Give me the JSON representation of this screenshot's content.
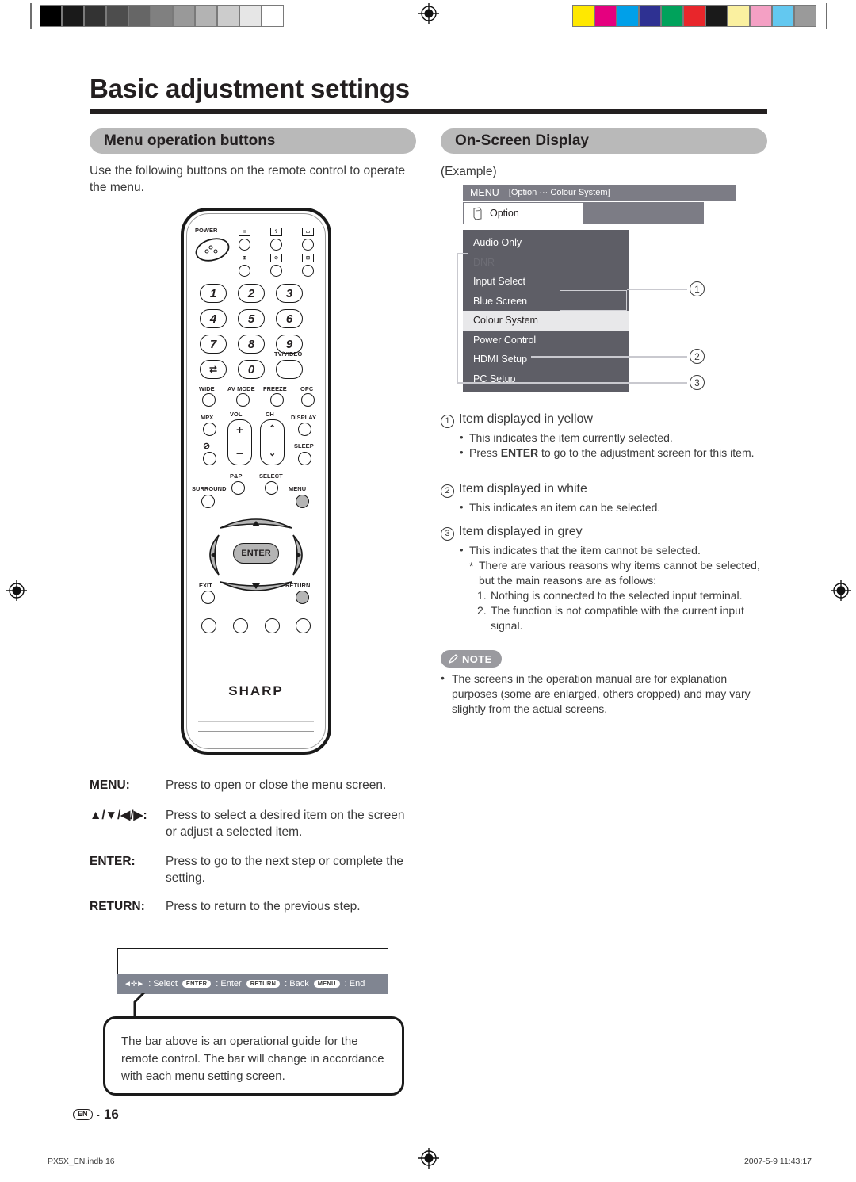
{
  "page": {
    "title": "Basic adjustment settings",
    "folio_badge": "EN",
    "folio_separator": "-",
    "folio_number": "16",
    "footer_left": "PX5X_EN.indb   16",
    "footer_right": "2007-5-9   11:43:17"
  },
  "print_marks": {
    "greyscale_swatches": [
      "#000000",
      "#1a1a1a",
      "#333333",
      "#4d4d4d",
      "#666666",
      "#808080",
      "#999999",
      "#b3b3b3",
      "#cccccc",
      "#e6e6e6",
      "#ffffff"
    ],
    "color_swatches": [
      "#ffe800",
      "#e5007f",
      "#00a0e9",
      "#2e3192",
      "#00a25b",
      "#e8262b",
      "#1a1a1a",
      "#faf0a0",
      "#f4a0c4",
      "#63c8f0",
      "#9a9a9a"
    ]
  },
  "left_column": {
    "section_title": "Menu operation buttons",
    "intro": "Use the following buttons on the remote control to operate the menu.",
    "remote": {
      "power_label": "POWER",
      "number_keys": [
        "1",
        "2",
        "3",
        "4",
        "5",
        "6",
        "7",
        "8",
        "9",
        "0"
      ],
      "tv_video_label": "TV/VIDEO",
      "function_row": [
        "WIDE",
        "AV MODE",
        "FREEZE",
        "OPC"
      ],
      "mpx_label": "MPX",
      "vol_label": "VOL",
      "ch_label": "CH",
      "display_label": "DISPLAY",
      "sleep_label": "SLEEP",
      "pnp_label": "P&P",
      "select_label": "SELECT",
      "surround_label": "SURROUND",
      "menu_label": "MENU",
      "enter_label": "ENTER",
      "exit_label": "EXIT",
      "return_label": "RETURN",
      "brand": "SHARP",
      "icon_glyphs": {
        "vol_plus": "+",
        "vol_minus": "−",
        "ch_up": "⌃",
        "ch_down": "⌄",
        "up": "▲",
        "down": "▼",
        "left": "◀",
        "right": "▶",
        "flashback": "⮂",
        "mute": "🔇"
      }
    },
    "key_descriptions": [
      {
        "key": "MENU:",
        "desc": "Press to open or close the menu screen."
      },
      {
        "key": "▲/▼/◀/▶:",
        "desc": "Press to select a desired item on the screen or adjust a selected item."
      },
      {
        "key": "ENTER:",
        "desc": "Press to go to the next step or complete the setting."
      },
      {
        "key": "RETURN:",
        "desc": "Press to return to the previous step."
      }
    ],
    "guide_bar": {
      "items": [
        {
          "key": "",
          "icon": "arrows-icon",
          "label": ": Select"
        },
        {
          "key": "ENTER",
          "label": ": Enter"
        },
        {
          "key": "RETURN",
          "label": ": Back"
        },
        {
          "key": "MENU",
          "label": ": End"
        }
      ]
    },
    "callout": "The bar above is an operational guide for the remote control. The bar will change in accordance with each menu setting screen."
  },
  "right_column": {
    "section_title": "On-Screen Display",
    "example_label": "(Example)",
    "osd": {
      "menu_label": "MENU",
      "breadcrumb": "[Option ··· Colour System]",
      "tab_label": "Option",
      "items": [
        {
          "label": "Audio Only",
          "state": "normal"
        },
        {
          "label": "DNR",
          "state": "disabled"
        },
        {
          "label": "Input Select",
          "state": "normal"
        },
        {
          "label": "Blue Screen",
          "state": "normal"
        },
        {
          "label": "Colour System",
          "state": "selected"
        },
        {
          "label": "Power Control",
          "state": "normal"
        },
        {
          "label": "HDMI Setup",
          "state": "normal"
        },
        {
          "label": "PC Setup",
          "state": "normal"
        }
      ],
      "callout_numbers": [
        "1",
        "2",
        "3"
      ]
    },
    "explanations": [
      {
        "num": "1",
        "heading": "Item displayed in yellow",
        "bullets": [
          "This indicates the item currently selected.",
          "Press ENTER to go to the adjustment screen for this item."
        ],
        "bullet_bold": [
          "",
          "ENTER"
        ]
      },
      {
        "num": "2",
        "heading": "Item displayed in white",
        "bullets": [
          "This indicates an item can be selected."
        ]
      },
      {
        "num": "3",
        "heading": "Item displayed in grey",
        "bullets": [
          "This indicates that the item cannot be selected."
        ],
        "star_note": "There are various reasons why items cannot be selected, but the main reasons are as follows:",
        "numbered": [
          {
            "n": "1.",
            "text": "Nothing is connected to the selected input terminal."
          },
          {
            "n": "2.",
            "text": "The function is not compatible with the current input signal."
          }
        ]
      }
    ],
    "note": {
      "badge": "NOTE",
      "text": "The screens in the operation manual are for explanation purposes (some are enlarged, others cropped) and may vary slightly from the actual screens."
    }
  }
}
